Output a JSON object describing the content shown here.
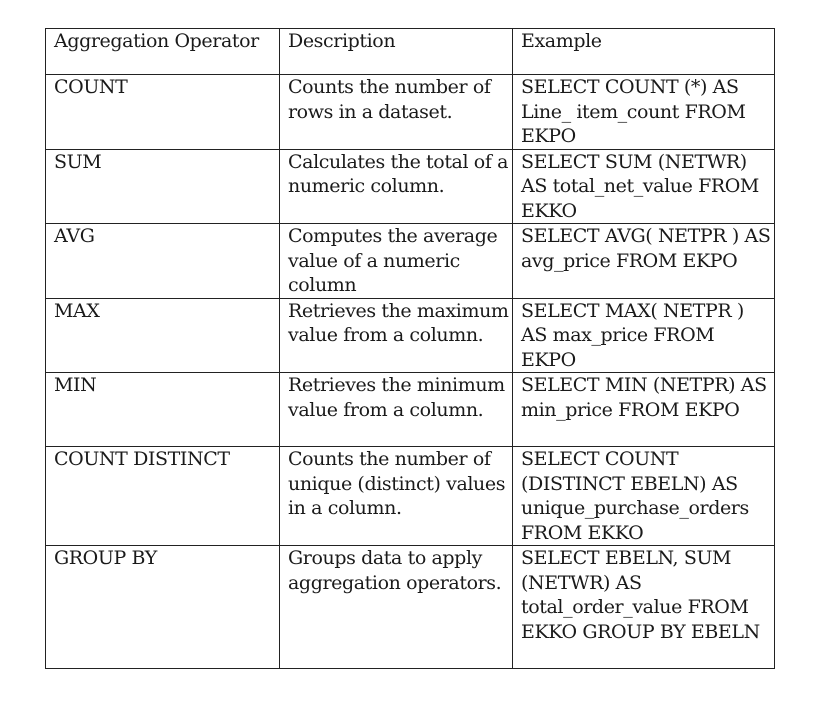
{
  "table": {
    "headers": [
      "Aggregation Operator",
      "Description",
      "Example"
    ],
    "rows": [
      {
        "operator": "COUNT",
        "description": "Counts the number of rows in a dataset.",
        "example": "SELECT COUNT (*) AS Line_ item_count FROM EKPO"
      },
      {
        "operator": "SUM",
        "description": "Calculates the total of a numeric column.",
        "example": "SELECT SUM (NETWR) AS total_net_value FROM EKKO"
      },
      {
        "operator": "AVG",
        "description": "Computes the average value of a numeric column",
        "example": "SELECT AVG( NETPR ) AS avg_price FROM EKPO"
      },
      {
        "operator": "MAX",
        "description": "Retrieves the maximum value from a column.",
        "example": "SELECT MAX( NETPR ) AS max_price FROM EKPO"
      },
      {
        "operator": "MIN",
        "description": "Retrieves the minimum value from a column.",
        "example": "SELECT MIN (NETPR) AS min_price FROM EKPO"
      },
      {
        "operator": "COUNT DISTINCT",
        "description": "Counts the number of unique (distinct) values in a column.",
        "example": "SELECT COUNT (DISTINCT EBELN) AS unique_purchase_orders FROM EKKO"
      },
      {
        "operator": "GROUP BY",
        "description": "Groups data to apply aggregation operators.",
        "example": "SELECT EBELN, SUM (NETWR) AS total_order_value FROM EKKO GROUP BY EBELN"
      }
    ]
  }
}
